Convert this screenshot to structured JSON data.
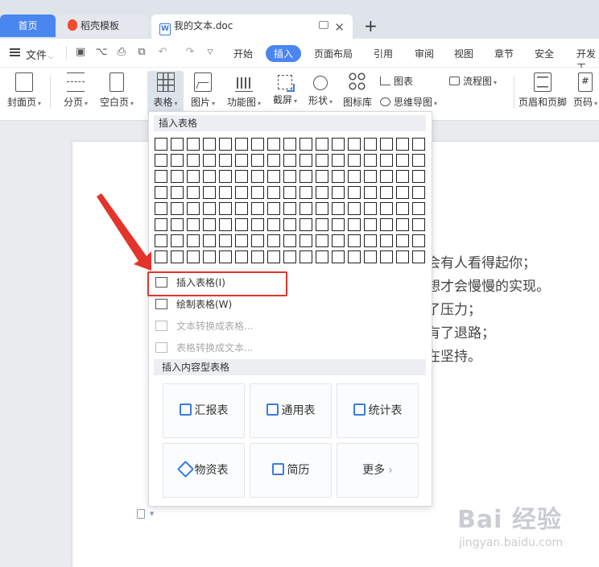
{
  "tabs": {
    "home": "首页",
    "template": "稻壳模板",
    "document": "我的文本.doc",
    "add": "+"
  },
  "menubar": {
    "file": "文件",
    "items": [
      "开始",
      "插入",
      "页面布局",
      "引用",
      "审阅",
      "视图",
      "章节",
      "安全",
      "开发工"
    ],
    "active_index": 1
  },
  "ribbon": {
    "cover": "封面页",
    "page_break": "分页",
    "blank_page": "空白页",
    "table": "表格",
    "picture": "图片",
    "function_chart": "功能图",
    "screenshot": "截屏",
    "shape": "形状",
    "icon_library": "图标库",
    "chart": "图表",
    "mind_map": "思维导图",
    "flowchart": "流程图",
    "header_footer": "页眉和页脚",
    "page_number": "页码"
  },
  "dropdown": {
    "insert_table_header": "插入表格",
    "grid_rows": 8,
    "grid_cols": 17,
    "options": [
      {
        "label": "插入表格(I)",
        "enabled": true
      },
      {
        "label": "绘制表格(W)",
        "enabled": true
      },
      {
        "label": "文本转换成表格...",
        "enabled": false
      },
      {
        "label": "表格转换成文本...",
        "enabled": false
      }
    ],
    "content_table_header": "插入内容型表格",
    "cards": [
      "汇报表",
      "通用表",
      "统计表",
      "物资表",
      "简历",
      "更多"
    ]
  },
  "document": {
    "lines": [
      "会有人看得起你；",
      "想才会慢慢的实现。",
      "了压力；",
      "有了退路；",
      "在坚持。"
    ]
  },
  "watermark": {
    "text": "Bai 经验",
    "url": "jingyan.baidu.com"
  },
  "colors": {
    "accent": "#4a86ef",
    "highlight": "#e3332a"
  }
}
